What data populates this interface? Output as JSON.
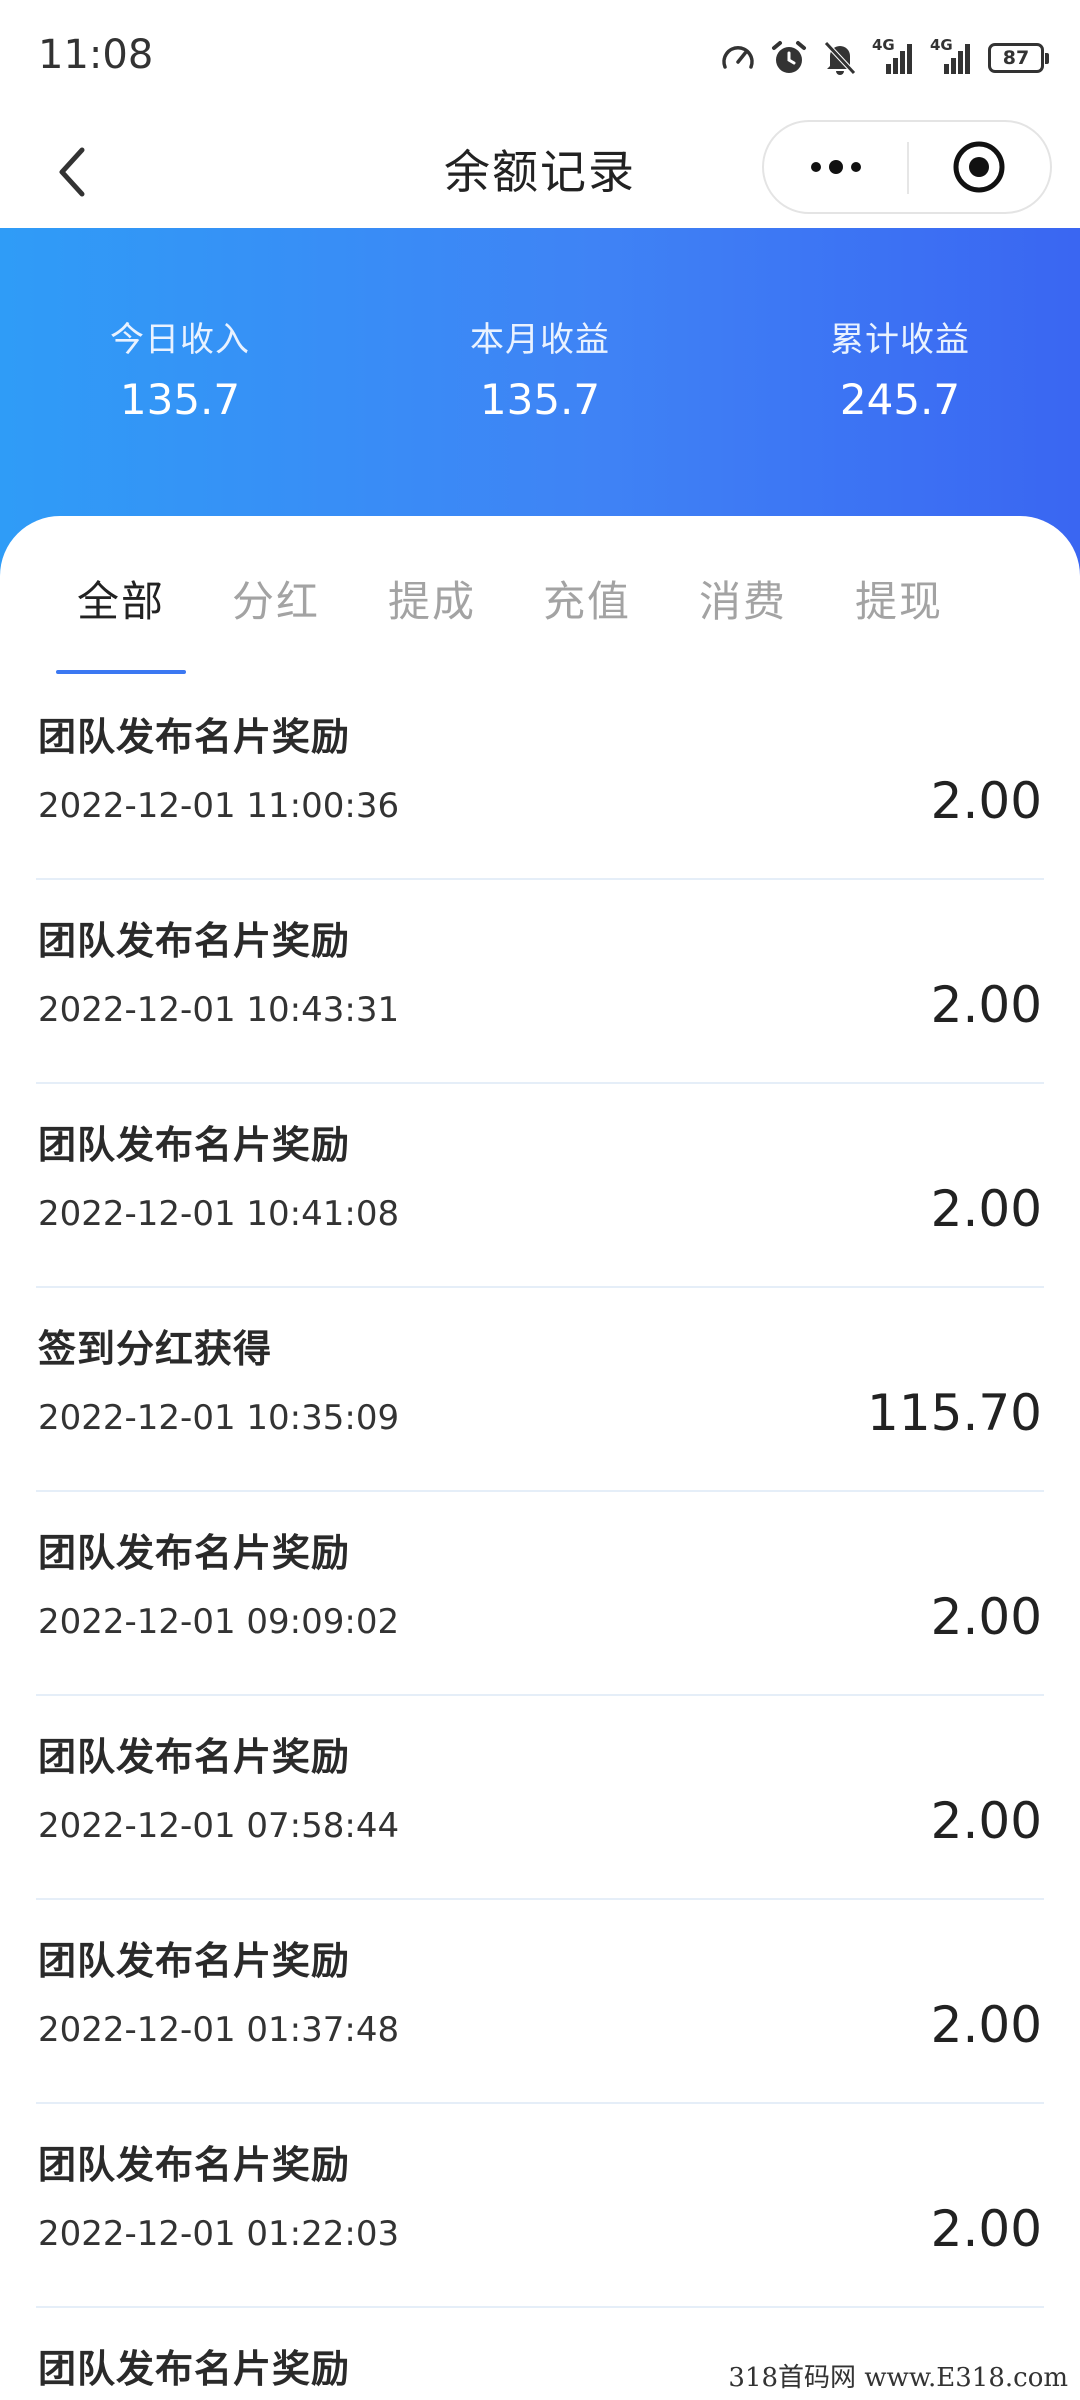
{
  "status_bar": {
    "time": "11:08",
    "network_1": "4G",
    "network_2": "4G",
    "battery": "87",
    "icons": [
      "speed-meter-icon",
      "alarm-icon",
      "bell-muted-icon",
      "signal-icon",
      "signal-icon",
      "battery-icon"
    ]
  },
  "nav": {
    "title": "余额记录",
    "back_icon": "chevron-left-icon",
    "more_icon": "more-dots-icon",
    "close_icon": "target-circle-icon"
  },
  "summary": {
    "today_label": "今日收入",
    "today_value": "135.7",
    "month_label": "本月收益",
    "month_value": "135.7",
    "total_label": "累计收益",
    "total_value": "245.7"
  },
  "tabs": [
    {
      "label": "全部",
      "active": true
    },
    {
      "label": "分红",
      "active": false
    },
    {
      "label": "提成",
      "active": false
    },
    {
      "label": "充值",
      "active": false
    },
    {
      "label": "消费",
      "active": false
    },
    {
      "label": "提现",
      "active": false
    }
  ],
  "records": [
    {
      "title": "团队发布名片奖励",
      "time": "2022-12-01 11:00:36",
      "amount": "2.00"
    },
    {
      "title": "团队发布名片奖励",
      "time": "2022-12-01 10:43:31",
      "amount": "2.00"
    },
    {
      "title": "团队发布名片奖励",
      "time": "2022-12-01 10:41:08",
      "amount": "2.00"
    },
    {
      "title": "签到分红获得",
      "time": "2022-12-01 10:35:09",
      "amount": "115.70"
    },
    {
      "title": "团队发布名片奖励",
      "time": "2022-12-01 09:09:02",
      "amount": "2.00"
    },
    {
      "title": "团队发布名片奖励",
      "time": "2022-12-01 07:58:44",
      "amount": "2.00"
    },
    {
      "title": "团队发布名片奖励",
      "time": "2022-12-01 01:37:48",
      "amount": "2.00"
    },
    {
      "title": "团队发布名片奖励",
      "time": "2022-12-01 01:22:03",
      "amount": "2.00"
    },
    {
      "title": "团队发布名片奖励",
      "time": "",
      "amount": ""
    }
  ],
  "watermark": "318首码网 www.E318.com",
  "colors": {
    "header_gradient_start": "#2f9cf7",
    "header_gradient_end": "#3a66f2",
    "tab_active_underline": "#3b78f2",
    "tab_inactive": "#a3a3a3"
  }
}
